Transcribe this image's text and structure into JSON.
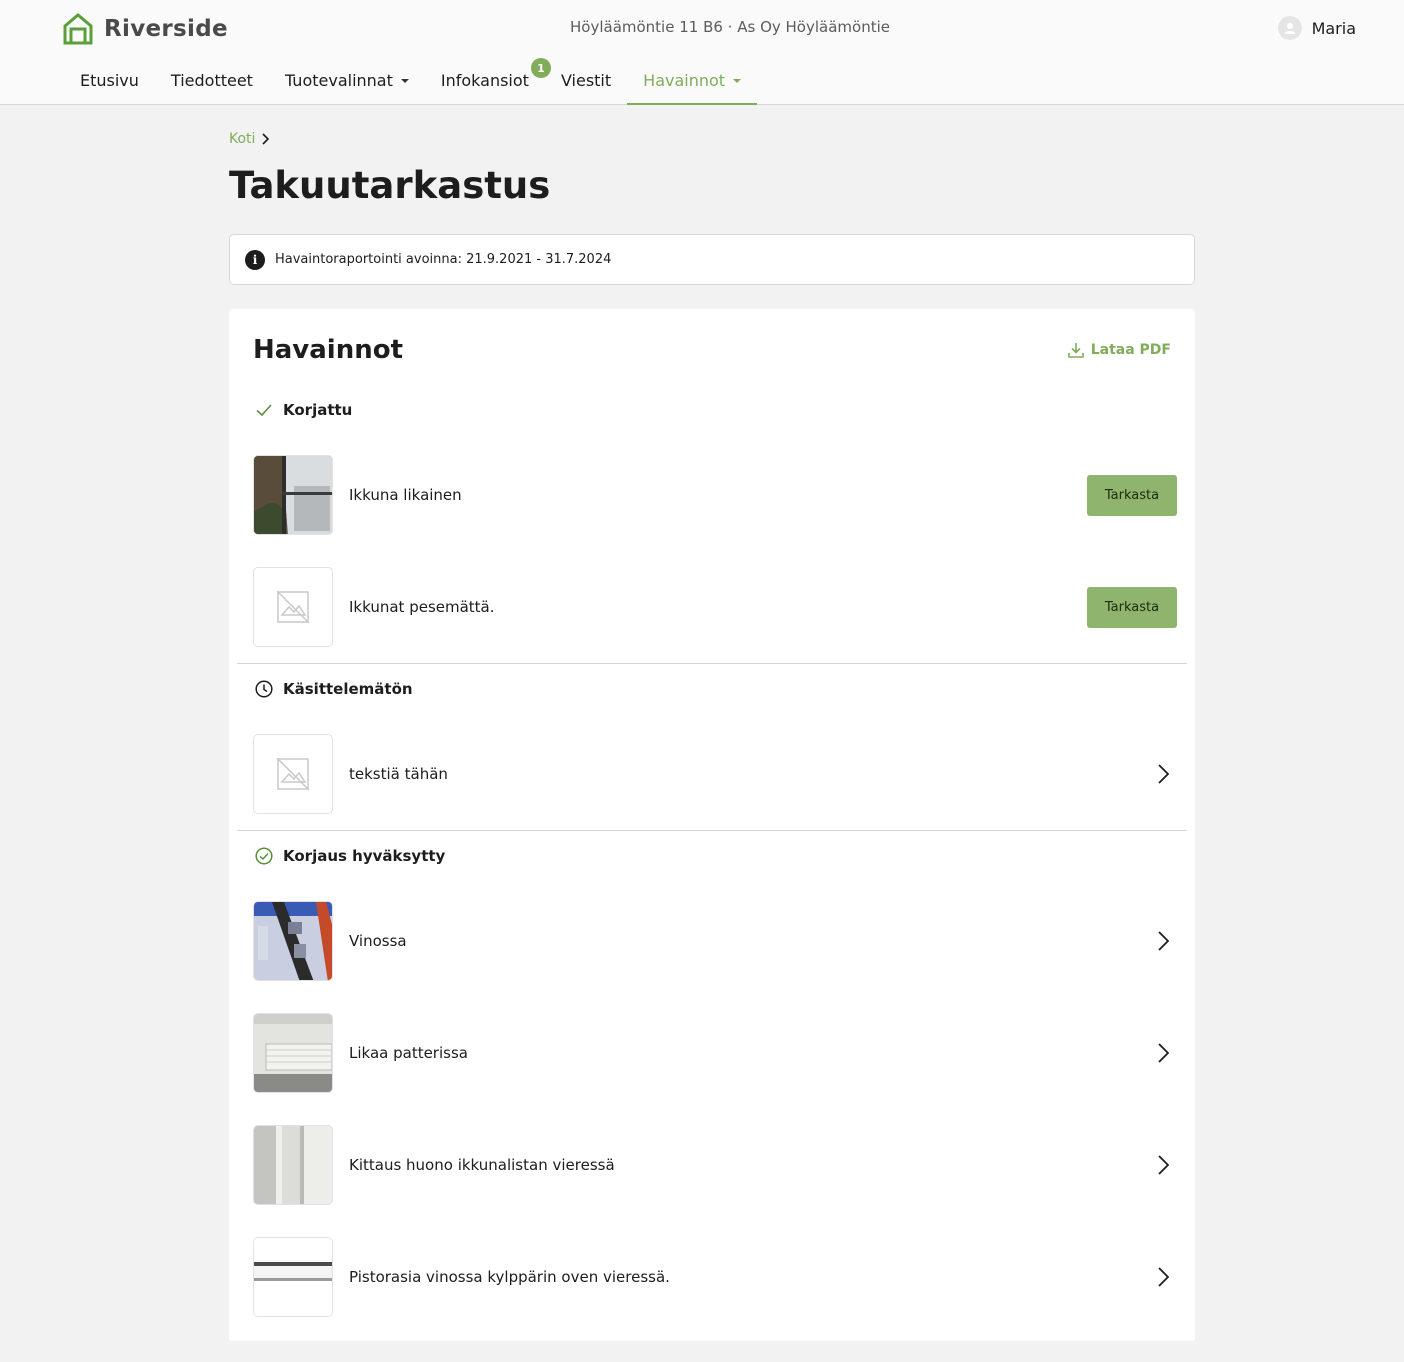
{
  "header": {
    "brand": "Riverside",
    "address": "Höyläämöntie 11 B6 · As Oy Höyläämöntie",
    "user_name": "Maria",
    "nav": [
      {
        "label": "Etusivu",
        "dropdown": false
      },
      {
        "label": "Tiedotteet",
        "dropdown": false
      },
      {
        "label": "Tuotevalinnat",
        "dropdown": true
      },
      {
        "label": "Infokansiot",
        "dropdown": false,
        "badge": "1"
      },
      {
        "label": "Viestit",
        "dropdown": false
      },
      {
        "label": "Havainnot",
        "dropdown": true,
        "active": true
      }
    ]
  },
  "breadcrumb": {
    "home": "Koti"
  },
  "page_title": "Takuutarkastus",
  "info": {
    "text": "Havaintoraportointi avoinna: 21.9.2021 - 31.7.2024"
  },
  "card": {
    "title": "Havainnot",
    "pdf_label": "Lataa PDF",
    "sections": [
      {
        "heading": "Korjattu",
        "icon": "check-icon",
        "items": [
          {
            "label": "Ikkuna likainen",
            "action": "Tarkasta",
            "thumb": "photo"
          },
          {
            "label": "Ikkunat pesemättä.",
            "action": "Tarkasta",
            "thumb": "placeholder"
          }
        ]
      },
      {
        "heading": "Käsittelemätön",
        "icon": "clock-icon",
        "items": [
          {
            "label": "tekstiä tähän",
            "thumb": "placeholder"
          }
        ]
      },
      {
        "heading": "Korjaus hyväksytty",
        "icon": "check-circle-icon",
        "items": [
          {
            "label": "Vinossa",
            "thumb": "photo"
          },
          {
            "label": "Likaa patterissa",
            "thumb": "photo"
          },
          {
            "label": "Kittaus huono ikkunalistan vieressä",
            "thumb": "photo"
          },
          {
            "label": "Pistorasia vinossa kylppärin oven vieressä.",
            "thumb": "photo"
          }
        ]
      }
    ]
  },
  "colors": {
    "accent": "#80ad5a",
    "button": "#8eb46d"
  }
}
